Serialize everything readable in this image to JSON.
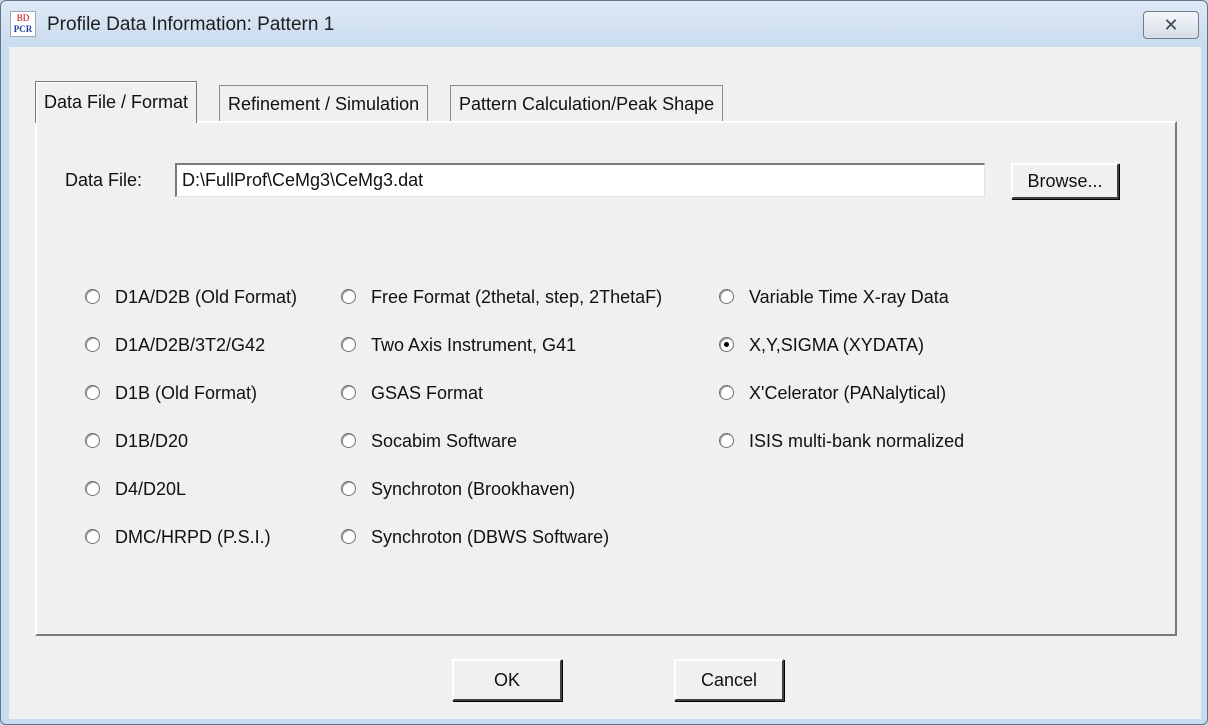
{
  "window": {
    "title": "Profile Data Information: Pattern 1",
    "icon_top": "BD PCR",
    "close_glyph": "✕"
  },
  "tabs": [
    {
      "label": "Data File / Format",
      "active": true
    },
    {
      "label": "Refinement / Simulation",
      "active": false
    },
    {
      "label": "Pattern Calculation/Peak Shape",
      "active": false
    }
  ],
  "data_file": {
    "label": "Data File:",
    "value": "D:\\FullProf\\CeMg3\\CeMg3.dat",
    "browse_label": "Browse..."
  },
  "formats": {
    "column1": [
      {
        "label": "D1A/D2B (Old Format)",
        "checked": false
      },
      {
        "label": "D1A/D2B/3T2/G42",
        "checked": false
      },
      {
        "label": "D1B (Old Format)",
        "checked": false
      },
      {
        "label": "D1B/D20",
        "checked": false
      },
      {
        "label": "D4/D20L",
        "checked": false
      },
      {
        "label": "DMC/HRPD (P.S.I.)",
        "checked": false
      }
    ],
    "column2": [
      {
        "label": "Free Format (2thetal, step, 2ThetaF)",
        "checked": false
      },
      {
        "label": "Two Axis Instrument, G41",
        "checked": false
      },
      {
        "label": "GSAS Format",
        "checked": false
      },
      {
        "label": "Socabim Software",
        "checked": false
      },
      {
        "label": "Synchroton (Brookhaven)",
        "checked": false
      },
      {
        "label": "Synchroton (DBWS Software)",
        "checked": false
      }
    ],
    "column3": [
      {
        "label": "Variable Time X-ray Data",
        "checked": false
      },
      {
        "label": "X,Y,SIGMA (XYDATA)",
        "checked": true
      },
      {
        "label": "X'Celerator (PANalytical)",
        "checked": false
      },
      {
        "label": "ISIS multi-bank normalized",
        "checked": false
      }
    ]
  },
  "buttons": {
    "ok": "OK",
    "cancel": "Cancel"
  }
}
